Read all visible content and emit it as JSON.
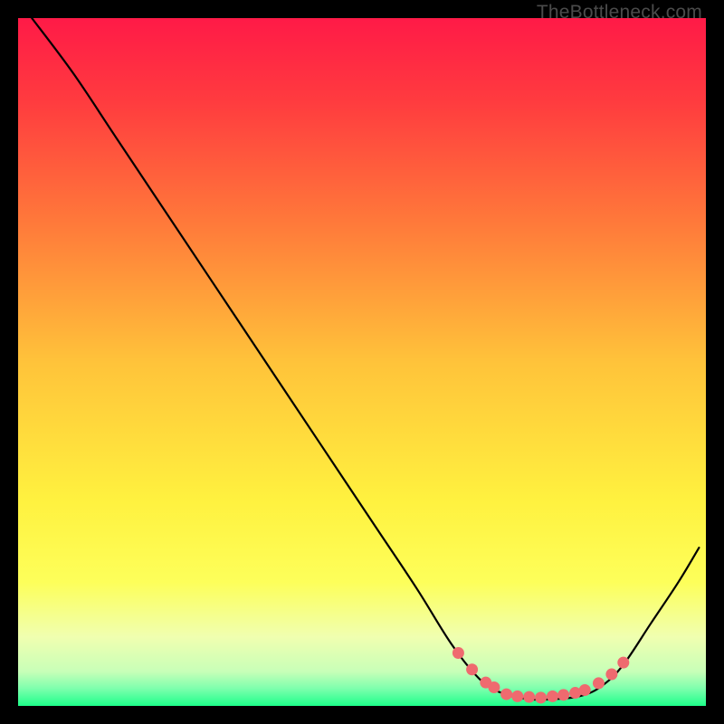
{
  "watermark": "TheBottleneck.com",
  "chart_data": {
    "type": "line",
    "title": "",
    "xlabel": "",
    "ylabel": "",
    "xlim": [
      0,
      100
    ],
    "ylim": [
      0,
      100
    ],
    "background_gradient": {
      "stops": [
        {
          "pos": 0.0,
          "color": "#ff1a47"
        },
        {
          "pos": 0.12,
          "color": "#ff3b3f"
        },
        {
          "pos": 0.3,
          "color": "#ff7a3a"
        },
        {
          "pos": 0.5,
          "color": "#ffc33a"
        },
        {
          "pos": 0.7,
          "color": "#fff13f"
        },
        {
          "pos": 0.82,
          "color": "#fdff5a"
        },
        {
          "pos": 0.9,
          "color": "#f0ffb0"
        },
        {
          "pos": 0.95,
          "color": "#c8ffb8"
        },
        {
          "pos": 0.975,
          "color": "#7dffad"
        },
        {
          "pos": 1.0,
          "color": "#1eff8a"
        }
      ]
    },
    "series": [
      {
        "name": "curve",
        "stroke": "#000000",
        "stroke_width": 2.2,
        "points": [
          {
            "x": 2,
            "y": 100
          },
          {
            "x": 8,
            "y": 92
          },
          {
            "x": 14,
            "y": 83
          },
          {
            "x": 20,
            "y": 74
          },
          {
            "x": 28,
            "y": 62
          },
          {
            "x": 36,
            "y": 50
          },
          {
            "x": 44,
            "y": 38
          },
          {
            "x": 52,
            "y": 26
          },
          {
            "x": 58,
            "y": 17
          },
          {
            "x": 63,
            "y": 9
          },
          {
            "x": 67,
            "y": 4
          },
          {
            "x": 70,
            "y": 2
          },
          {
            "x": 74,
            "y": 1
          },
          {
            "x": 78,
            "y": 1
          },
          {
            "x": 82,
            "y": 1.5
          },
          {
            "x": 85,
            "y": 3
          },
          {
            "x": 88,
            "y": 6
          },
          {
            "x": 92,
            "y": 12
          },
          {
            "x": 96,
            "y": 18
          },
          {
            "x": 99,
            "y": 23
          }
        ]
      },
      {
        "name": "optimal-zone",
        "type": "dots",
        "fill": "#ef6a6f",
        "radius": 6.5,
        "points": [
          {
            "x": 64,
            "y": 7.7
          },
          {
            "x": 66,
            "y": 5.3
          },
          {
            "x": 68,
            "y": 3.4
          },
          {
            "x": 69.2,
            "y": 2.7
          },
          {
            "x": 71,
            "y": 1.7
          },
          {
            "x": 72.6,
            "y": 1.4
          },
          {
            "x": 74.3,
            "y": 1.3
          },
          {
            "x": 76,
            "y": 1.2
          },
          {
            "x": 77.7,
            "y": 1.4
          },
          {
            "x": 79.3,
            "y": 1.6
          },
          {
            "x": 81,
            "y": 1.9
          },
          {
            "x": 82.4,
            "y": 2.3
          },
          {
            "x": 84.4,
            "y": 3.3
          },
          {
            "x": 86.3,
            "y": 4.6
          },
          {
            "x": 88,
            "y": 6.3
          }
        ]
      }
    ]
  }
}
